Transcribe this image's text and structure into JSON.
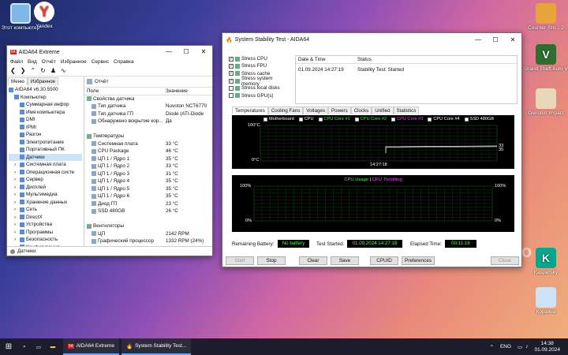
{
  "desktop": {
    "icons": [
      {
        "label": "Этот компьютер",
        "icon": "computer-icon",
        "color": "#7fb7e6"
      },
      {
        "label": "Yandex",
        "icon": "yandex-icon",
        "color": "#ffcc00"
      },
      {
        "label": "Counter-Stri... 2",
        "icon": "cs2-icon",
        "color": "#e8a33a"
      },
      {
        "label": "Grand Theft Auto V",
        "icon": "gta-icon",
        "color": "#2e6e2e"
      },
      {
        "label": "Genshin Impact",
        "icon": "genshin-icon",
        "color": "#e8d7b8"
      },
      {
        "label": "Kaspersky",
        "icon": "kaspersky-icon",
        "color": "#00a88e"
      },
      {
        "label": "Корзина",
        "icon": "recycle-bin-icon",
        "color": "#cfe3f7"
      }
    ]
  },
  "aida": {
    "title": "AIDA64 Extreme",
    "menu": [
      "Файл",
      "Вид",
      "Отчёт",
      "Избранное",
      "Сервис",
      "Справка"
    ],
    "tabs": [
      "Меню",
      "Избранное"
    ],
    "report_label": "Отчёт",
    "tree": [
      {
        "label": "AIDA64 v6.30.5500",
        "level": 0
      },
      {
        "label": "Компьютер",
        "level": 1
      },
      {
        "label": "Суммарная инфор",
        "level": 2
      },
      {
        "label": "Имя компьютера",
        "level": 2
      },
      {
        "label": "DMI",
        "level": 2
      },
      {
        "label": "IPMI",
        "level": 2
      },
      {
        "label": "Разгон",
        "level": 2
      },
      {
        "label": "Электропитание",
        "level": 2
      },
      {
        "label": "Портативный ПК",
        "level": 2
      },
      {
        "label": "Датчики",
        "level": 2
      },
      {
        "label": "Системная плата",
        "level": 1
      },
      {
        "label": "Операционная систе",
        "level": 1
      },
      {
        "label": "Сервер",
        "level": 1
      },
      {
        "label": "Дисплей",
        "level": 1
      },
      {
        "label": "Мультимедиа",
        "level": 1
      },
      {
        "label": "Хранение данных",
        "level": 1
      },
      {
        "label": "Сеть",
        "level": 1
      },
      {
        "label": "DirectX",
        "level": 1
      },
      {
        "label": "Устройства",
        "level": 1
      },
      {
        "label": "Программы",
        "level": 1
      },
      {
        "label": "Безопасность",
        "level": 1
      },
      {
        "label": "Конфигурация",
        "level": 1
      }
    ],
    "columns": [
      "Поле",
      "Значение"
    ],
    "rows": [
      {
        "field": "Свойства датчика",
        "value": "",
        "section": true
      },
      {
        "field": "Тип датчика",
        "value": "Nuvoton NCT6770",
        "section": false
      },
      {
        "field": "Тип датчика ГП",
        "value": "Diode  (ATI-Diode",
        "section": false
      },
      {
        "field": "Обнаружено вскрытие кор...",
        "value": "Да",
        "section": false
      },
      {
        "field": "",
        "value": "",
        "section": false
      },
      {
        "field": "Температуры",
        "value": "",
        "section": true
      },
      {
        "field": "Системная плата",
        "value": "33 °C",
        "section": false
      },
      {
        "field": "CPU Package",
        "value": "46 °C",
        "section": false
      },
      {
        "field": "ЦП 1 / Ядро 1",
        "value": "35 °C",
        "section": false
      },
      {
        "field": "ЦП 1 / Ядро 2",
        "value": "33 °C",
        "section": false
      },
      {
        "field": "ЦП 1 / Ядро 3",
        "value": "31 °C",
        "section": false
      },
      {
        "field": "ЦП 1 / Ядро 4",
        "value": "35 °C",
        "section": false
      },
      {
        "field": "ЦП 1 / Ядро 5",
        "value": "35 °C",
        "section": false
      },
      {
        "field": "ЦП 1 / Ядро 6",
        "value": "35 °C",
        "section": false
      },
      {
        "field": "Диод ГП",
        "value": "23 °C",
        "section": false
      },
      {
        "field": "SSD 480GB",
        "value": "26 °C",
        "section": false
      },
      {
        "field": "",
        "value": "",
        "section": false
      },
      {
        "field": "Вентиляторы",
        "value": "",
        "section": true
      },
      {
        "field": "ЦП",
        "value": "2142 RPM",
        "section": false
      },
      {
        "field": "Графический процессор",
        "value": "1332 RPM  (24%)",
        "section": false
      }
    ],
    "status": "Датчики"
  },
  "sst": {
    "title": "System Stability Test - AIDA64",
    "checks": [
      {
        "label": "Stress CPU",
        "checked": true
      },
      {
        "label": "Stress FPU",
        "checked": true
      },
      {
        "label": "Stress cache",
        "checked": true
      },
      {
        "label": "Stress system memory",
        "checked": true
      },
      {
        "label": "Stress local disks",
        "checked": false
      },
      {
        "label": "Stress GPU(s)",
        "checked": false
      }
    ],
    "log_headers": [
      "Date & Time",
      "Status"
    ],
    "log_rows": [
      {
        "time": "01.09.2024 14:27:19",
        "status": "Stability Test: Started"
      }
    ],
    "tabs": [
      "Temperatures",
      "Cooling Fans",
      "Voltages",
      "Powers",
      "Clocks",
      "Unified",
      "Statistics"
    ],
    "legend": [
      {
        "label": "Motherboard",
        "color": "#ffffff"
      },
      {
        "label": "CPU",
        "color": "#ffffff"
      },
      {
        "label": "CPU Core #1",
        "color": "#3dff3d"
      },
      {
        "label": "CPU Core #2",
        "color": "#3dff3d"
      },
      {
        "label": "CPU Core #3",
        "color": "#ff44ff"
      },
      {
        "label": "CPU Core #4",
        "color": "#ffffff"
      },
      {
        "label": "SSD 480GB",
        "color": "#ffffff"
      }
    ],
    "temp_top": "100°C",
    "temp_bottom": "0°C",
    "temp_time": "14:27:18",
    "temp_right_value": "33",
    "temp_right_value2": "35",
    "usage_title_a": "CPU Usage",
    "usage_sep": "|",
    "usage_title_b": "CPU Throttling",
    "usage_top_left": "100%",
    "usage_bottom_left": "0%",
    "usage_top_right": "100%",
    "usage_bottom_right": "0%",
    "remaining_label": "Remaining Battery:",
    "remaining_value": "No battery",
    "started_label": "Test Started:",
    "started_value": "01.09.2024 14:27:18",
    "elapsed_label": "Elapsed Time:",
    "elapsed_value": "00:11:18",
    "buttons": [
      "Start",
      "Stop",
      "Clear",
      "Save",
      "CPUID",
      "Preferences",
      "Close"
    ]
  },
  "taskbar": {
    "apps": [
      {
        "label": "AIDA64 Extreme"
      },
      {
        "label": "System Stability Test..."
      }
    ],
    "lang": "ENG",
    "time": "14:38",
    "date": "01.09.2024"
  },
  "watermark": "Avito"
}
